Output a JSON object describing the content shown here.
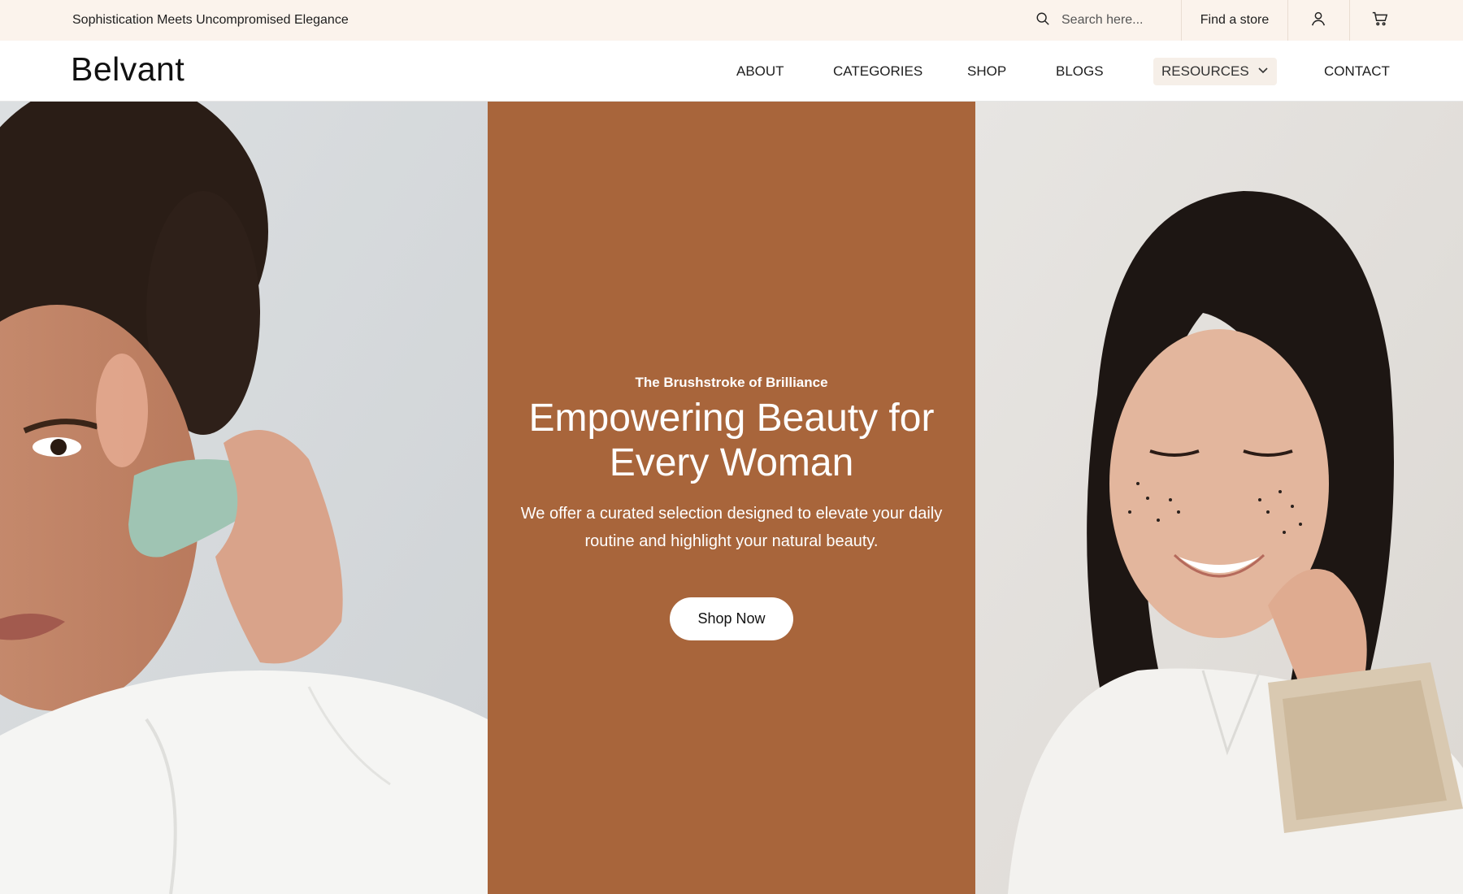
{
  "topbar": {
    "tagline": "Sophistication Meets Uncompromised Elegance",
    "search_placeholder": "Search here...",
    "find_store_label": "Find a store",
    "icons": [
      "search-icon",
      "user-icon",
      "cart-icon"
    ]
  },
  "header": {
    "logo": "Belvant",
    "nav": [
      {
        "label": "ABOUT"
      },
      {
        "label": "CATEGORIES"
      },
      {
        "label": "SHOP"
      },
      {
        "label": "BLOGS"
      },
      {
        "label": "RESOURCES",
        "has_dropdown": true,
        "highlighted": true
      },
      {
        "label": "CONTACT"
      }
    ]
  },
  "hero": {
    "eyebrow": "The Brushstroke of Brilliance",
    "headline": "Empowering Beauty for Every Woman",
    "subtext": "We offer a curated selection designed to elevate your daily routine and highlight your natural beauty.",
    "cta_label": "Shop Now",
    "accent_color": "#a8653b",
    "topbar_color": "#fbf3ec"
  }
}
